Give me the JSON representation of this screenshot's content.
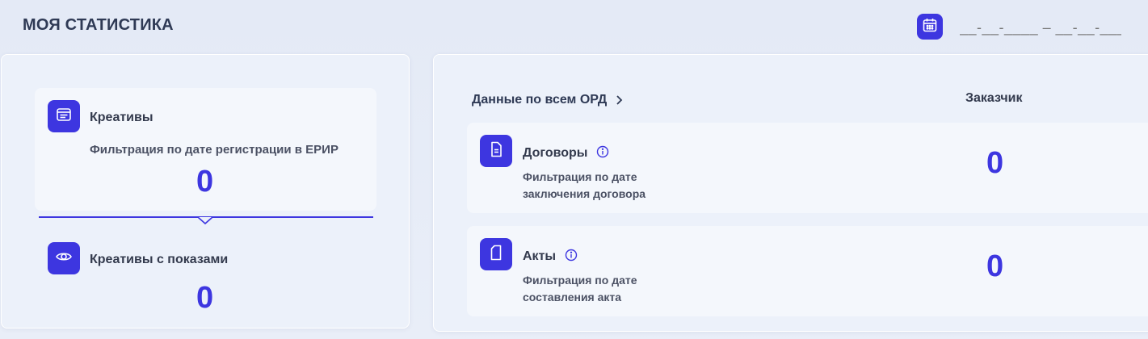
{
  "header": {
    "title": "МОЯ СТАТИСТИКА",
    "date_range_placeholder": "__-__-____ – __-__-____"
  },
  "left": {
    "creatives": {
      "title": "Креативы",
      "filter": "Фильтрация по дате регистрации в ЕРИР",
      "value": "0"
    },
    "creatives_shown": {
      "title": "Креативы с показами",
      "value": "0"
    }
  },
  "right": {
    "ord_link": "Данные по всем ОРД",
    "customer_header": "Заказчик",
    "rows": [
      {
        "title": "Договоры",
        "filter_line1": "Фильтрация по дате",
        "filter_line2": "заключения договора",
        "value": "0"
      },
      {
        "title": "Акты",
        "filter_line1": "Фильтрация по дате",
        "filter_line2": "составления акта",
        "value": "0"
      }
    ]
  },
  "colors": {
    "accent": "#3d36e0",
    "text": "#2f3a55",
    "card": "#ecf1fa"
  },
  "icons": [
    "calendar-icon",
    "creative-window-icon",
    "eye-icon",
    "chevron-right-icon",
    "document-icon",
    "info-icon",
    "page-icon"
  ]
}
